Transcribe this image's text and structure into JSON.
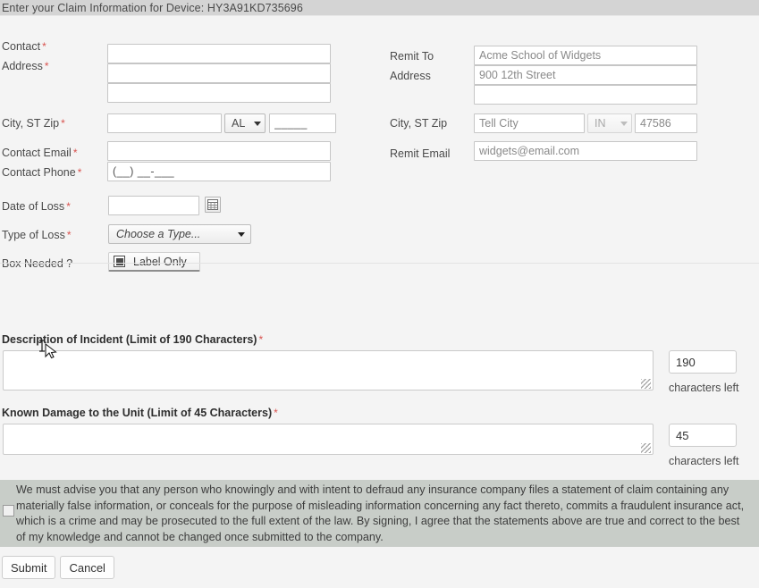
{
  "header": {
    "title": "Enter your Claim Information for Device: HY3A91KD735696"
  },
  "claimant_section": {
    "contact": {
      "label": "Contact",
      "required": "*",
      "value": "",
      "placeholder": ""
    },
    "address": {
      "label": "Address",
      "required": "*",
      "line1_value": "",
      "line2_value": ""
    },
    "city_st_zip": {
      "label": "City, ST Zip",
      "required": "*",
      "city_value": "",
      "state_selected": "AL",
      "zip_value": "_____"
    },
    "contact_email": {
      "label": "Contact Email",
      "required": "*",
      "value": ""
    },
    "contact_phone": {
      "label": "Contact Phone",
      "required": "*",
      "value": "(__) __-___"
    }
  },
  "remit_section": {
    "remit_to": {
      "label": "Remit To",
      "value": "Acme School of Widgets"
    },
    "address": {
      "label": "Address",
      "line1_value": "900 12th Street",
      "line2_value": ""
    },
    "city_st_zip": {
      "label": "City, ST Zip",
      "city_value": "Tell City",
      "state_selected": "IN",
      "zip_value": "47586"
    },
    "remit_email": {
      "label": "Remit Email",
      "value": "widgets@email.com"
    }
  },
  "loss_section": {
    "date_of_loss": {
      "label": "Date of Loss",
      "required": "*",
      "value": "",
      "calendar_icon": "calendar-icon"
    },
    "type_of_loss": {
      "label": "Type of Loss",
      "required": "*",
      "selected": "Choose a Type...",
      "caret_icon": "chevron-down-icon"
    },
    "box_needed": {
      "label": "Box Needed ?",
      "toggle_label": "Label Only",
      "toggle_icon": "filled-square-icon",
      "checked": true
    }
  },
  "description_section": {
    "label": "Description of Incident (Limit of 190 Characters)",
    "required": "*",
    "value": "",
    "counter_value": "190",
    "counter_caption": "characters left"
  },
  "damage_section": {
    "label": "Known Damage to the Unit (Limit of 45 Characters)",
    "required": "*",
    "value": "",
    "counter_value": "45",
    "counter_caption": "characters left"
  },
  "disclaimer": {
    "checkbox_checked": false,
    "text": "We must advise you that any person who knowingly and with intent to defraud any insurance company files a statement of claim containing any materially false information, or conceals for the purpose of misleading information concerning any fact thereto, commits a fraudulent insurance act, which is a crime and may be prosecuted to the full extent of the law. By signing, I agree that the statements above are true and correct to the best of my knowledge and cannot be changed once submitted to the company."
  },
  "footer": {
    "submit_label": "Submit",
    "cancel_label": "Cancel"
  },
  "colors": {
    "header_bar": "#d4d4d4",
    "page_background": "#f4f4f4",
    "disclaimer_background": "#c8cdc8",
    "required_asterisk": "#d9534f",
    "input_border": "#c6c6c6",
    "readonly_text": "#8a8a8a"
  }
}
